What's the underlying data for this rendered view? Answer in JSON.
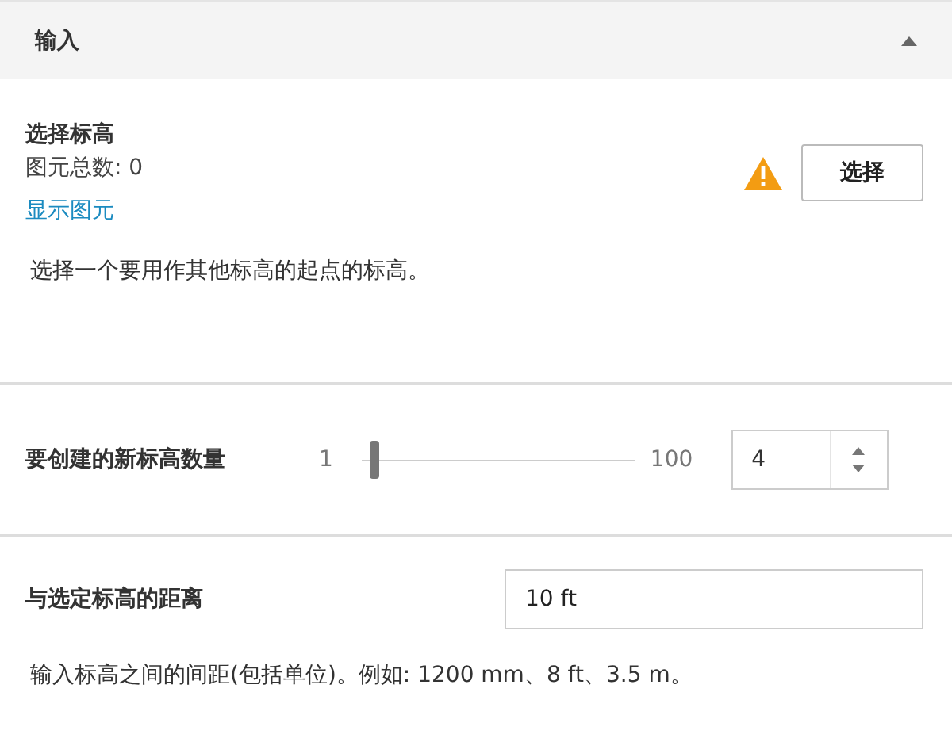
{
  "panel": {
    "title": "输入",
    "expanded": true
  },
  "select_level": {
    "title": "选择标高",
    "count": "图元总数: 0",
    "link": "显示图元",
    "warning": true,
    "button": "选择",
    "description": "选择一个要用作其他标高的起点的标高。"
  },
  "level_count": {
    "label": "要创建的新标高数量",
    "min": "1",
    "max": "100",
    "level": 0.03,
    "value": "4"
  },
  "distance": {
    "label": "与选定标高的距离",
    "value": "10 ft",
    "hint": "输入标高之间的间距(包括单位)。例如: 1200 mm、8 ft、3.5 m。"
  }
}
